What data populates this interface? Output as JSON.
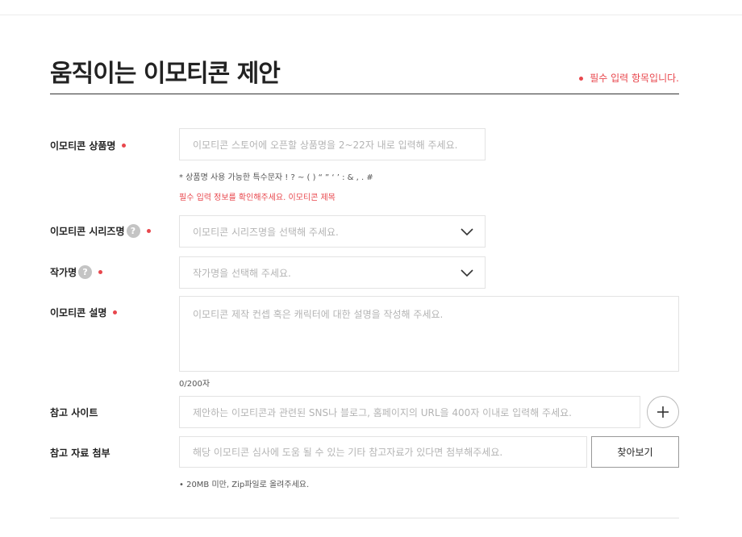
{
  "header": {
    "title": "움직이는 이모티콘 제안",
    "required_note": "필수 입력 항목입니다."
  },
  "fields": {
    "product_name": {
      "label": "이모티콘 상품명",
      "placeholder": "이모티콘 스토어에 오픈할 상품명을 2~22자 내로 입력해 주세요.",
      "hint": "* 상품명 사용 가능한 특수문자 ! ? ~ ( ) “ ” ‘ ’ : & , . #",
      "error": "필수 입력 정보를 확인해주세요. 이모티콘 제목"
    },
    "series_name": {
      "label": "이모티콘 시리즈명",
      "help": "?",
      "placeholder": "이모티콘 시리즈명을 선택해 주세요."
    },
    "author_name": {
      "label": "작가명",
      "help": "?",
      "placeholder": "작가명을 선택해 주세요."
    },
    "description": {
      "label": "이모티콘 설명",
      "placeholder": "이모티콘 제작 컨셉 혹은 캐릭터에 대한 설명을 작성해 주세요.",
      "counter": "0/200자"
    },
    "reference_site": {
      "label": "참고 사이트",
      "placeholder": "제안하는 이모티콘과 관련된 SNS나 블로그, 홈페이지의 URL을 400자 이내로 입력해 주세요."
    },
    "attachment": {
      "label": "참고 자료 첨부",
      "placeholder": "해당 이모티콘 심사에 도움 될 수 있는 기타 참고자료가 있다면 첨부해주세요.",
      "browse_label": "찾아보기",
      "hint": "• 20MB 미만, Zip파일로 올려주세요."
    }
  },
  "colors": {
    "accent": "#e8474d",
    "border": "#e3e3e3",
    "placeholder": "#b4b4b4",
    "text": "#222222"
  },
  "icons": {
    "required": "red-dot-icon",
    "help": "question-circle-icon",
    "dropdown": "chevron-down-icon",
    "add": "plus-icon"
  }
}
